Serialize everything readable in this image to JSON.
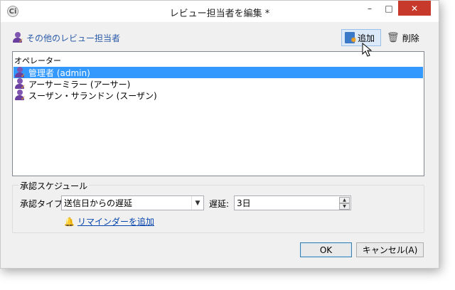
{
  "window": {
    "title": "レビュー担当者を編集 *",
    "app_icon": "Ci",
    "minimize": "–",
    "maximize": "□",
    "close": "✕"
  },
  "reviewers": {
    "label": "その他のレビュー担当者",
    "add_label": "追加",
    "delete_label": "削除"
  },
  "list": {
    "header": "オペレーター",
    "items": [
      {
        "label": "管理者 (admin)",
        "selected": true
      },
      {
        "label": "アーサーミラー (アーサー)",
        "selected": false
      },
      {
        "label": "スーザン・サランドン (スーザン)",
        "selected": false
      }
    ]
  },
  "schedule": {
    "legend": "承認スケジュール",
    "type_label": "承認タイプ:",
    "type_value": "送信日からの遅延",
    "delay_label": "遅延:",
    "delay_value": "3日",
    "reminder_link": "リマインダーを追加"
  },
  "buttons": {
    "ok": "OK",
    "cancel": "キャンセル(A)"
  },
  "colors": {
    "selection": "#3399ff",
    "close_button": "#c7392b",
    "link": "#0645ad"
  }
}
